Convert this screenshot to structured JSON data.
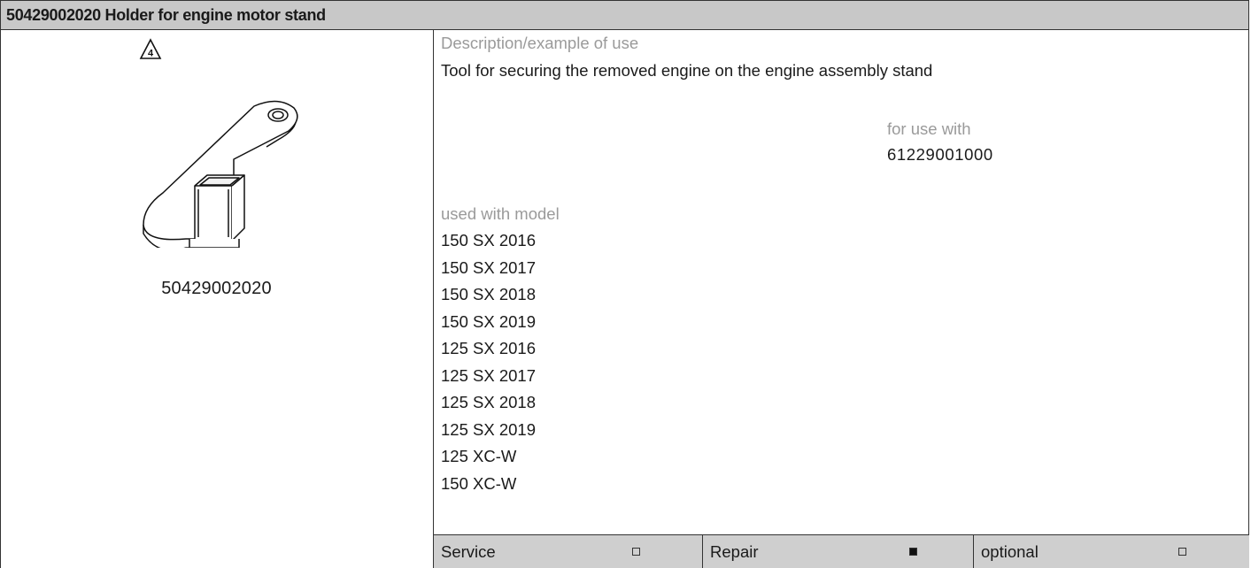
{
  "header": {
    "title": "50429002020 Holder for engine motor stand"
  },
  "left": {
    "warning_number": "4",
    "part_number": "50429002020"
  },
  "description": {
    "label": "Description/example of use",
    "text": "Tool for securing the removed engine on the engine assembly stand"
  },
  "for_use_with": {
    "label": "for use with",
    "value": "61229001000"
  },
  "models": {
    "label": "used with model",
    "items": [
      "150 SX 2016",
      "150 SX 2017",
      "150 SX 2018",
      "150 SX 2019",
      "125 SX 2016",
      "125 SX 2017",
      "125 SX 2018",
      "125 SX 2019",
      "125 XC-W",
      "150 XC-W"
    ]
  },
  "footer": {
    "service_label": "Service",
    "service_checked": false,
    "repair_label": "Repair",
    "repair_checked": true,
    "optional_label": "optional",
    "optional_checked": false
  }
}
